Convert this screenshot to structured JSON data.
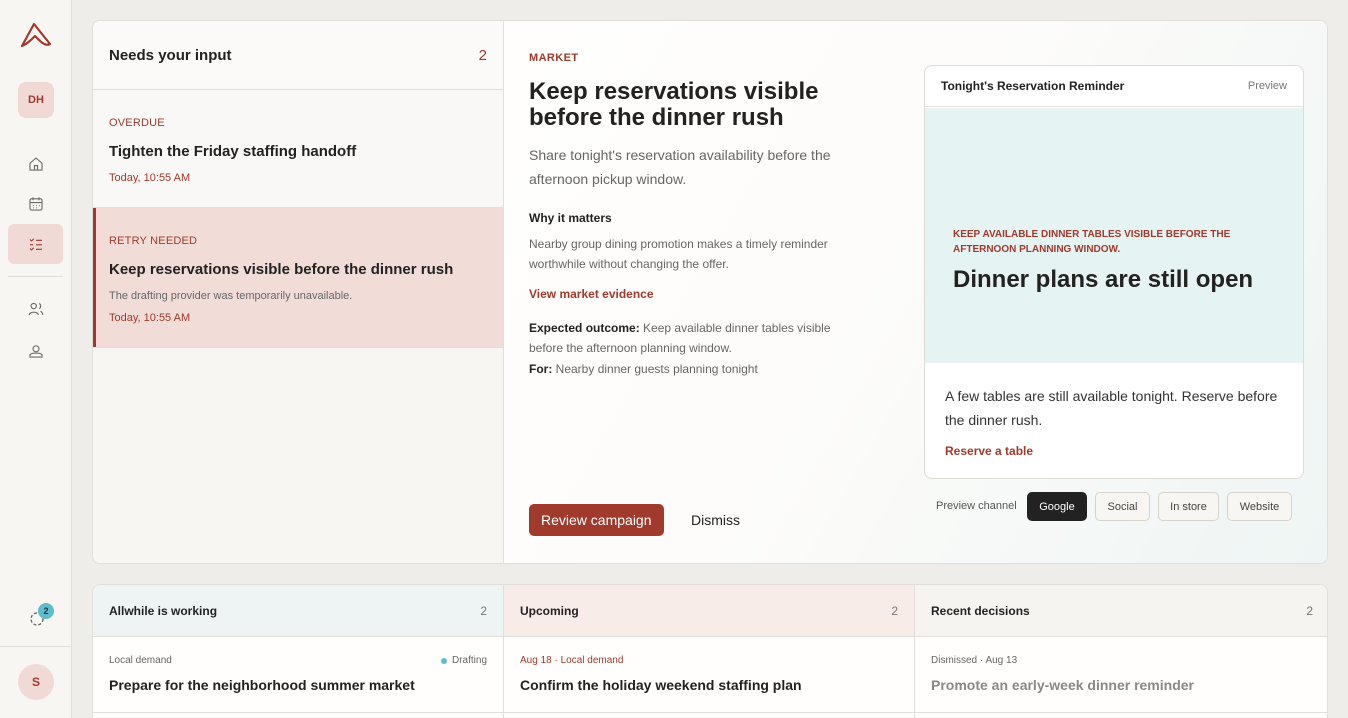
{
  "sidebar": {
    "workspace_initials": "DH",
    "user_initial": "S",
    "sync_badge": "2",
    "nav": [
      "home-icon",
      "calendar-icon",
      "checklist-icon",
      "users-icon",
      "profile-icon"
    ]
  },
  "inbox": {
    "title": "Needs your input",
    "count": "2",
    "items": [
      {
        "tag": "OVERDUE",
        "title": "Tighten the Friday staffing handoff",
        "desc": "",
        "time": "Today, 10:55 AM"
      },
      {
        "tag": "RETRY NEEDED",
        "title": "Keep reservations visible before the dinner rush",
        "desc": "The drafting provider was temporarily unavailable.",
        "time": "Today, 10:55 AM"
      }
    ]
  },
  "detail": {
    "category": "MARKET",
    "title": "Keep reservations visible before the dinner rush",
    "subtitle": "Share tonight's reservation availability before the afternoon pickup window.",
    "why_label": "Why it matters",
    "why_text": "Nearby group dining promotion makes a timely reminder worthwhile without changing the offer.",
    "evidence_link": "View market evidence",
    "outcome_label": "Expected outcome:",
    "outcome_text": "Keep available dinner tables visible before the afternoon planning window.",
    "for_label": "For:",
    "for_text": "Nearby dinner guests planning tonight",
    "review_button": "Review campaign",
    "dismiss_button": "Dismiss"
  },
  "preview": {
    "title": "Tonight's Reservation Reminder",
    "badge": "Preview",
    "kicker": "KEEP AVAILABLE DINNER TABLES VISIBLE BEFORE THE AFTERNOON PLANNING WINDOW.",
    "headline": "Dinner plans are still open",
    "body": "A few tables are still available tonight. Reserve before the dinner rush.",
    "cta": "Reserve a table",
    "channel_label": "Preview channel",
    "channels": [
      "Google",
      "Social",
      "In store",
      "Website"
    ],
    "selected_channel": "Google"
  },
  "panels": {
    "working": {
      "title": "Allwhile is working",
      "count": "2",
      "meta": "Local demand",
      "status": "Drafting",
      "item": "Prepare for the neighborhood summer market"
    },
    "upcoming": {
      "title": "Upcoming",
      "count": "2",
      "meta": "Aug 18 · Local demand",
      "item": "Confirm the holiday weekend staffing plan"
    },
    "recent": {
      "title": "Recent decisions",
      "count": "2",
      "meta": "Dismissed · Aug 13",
      "item": "Promote an early-week dinner reminder"
    }
  },
  "colors": {
    "accent": "#a03a2c",
    "accent_soft": "#f1d9d6",
    "teal": "#5fbccb"
  }
}
